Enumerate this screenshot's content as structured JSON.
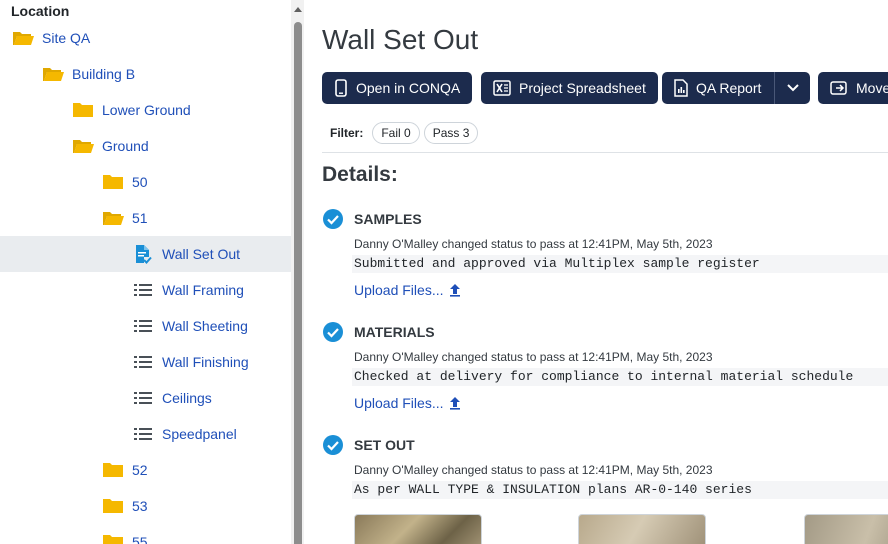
{
  "sidebar": {
    "title": "Location",
    "items": [
      {
        "label": "Site QA",
        "icon": "folder-open-icon"
      },
      {
        "label": "Building B",
        "icon": "folder-open-icon"
      },
      {
        "label": "Lower Ground",
        "icon": "folder-icon"
      },
      {
        "label": "Ground",
        "icon": "folder-open-icon"
      },
      {
        "label": "50",
        "icon": "folder-icon"
      },
      {
        "label": "51",
        "icon": "folder-open-icon"
      },
      {
        "label": "Wall Set Out",
        "icon": "checked-document-icon",
        "selected": true
      },
      {
        "label": "Wall Framing",
        "icon": "list-icon"
      },
      {
        "label": "Wall Sheeting",
        "icon": "list-icon"
      },
      {
        "label": "Wall Finishing",
        "icon": "list-icon"
      },
      {
        "label": "Ceilings",
        "icon": "list-icon"
      },
      {
        "label": "Speedpanel",
        "icon": "list-icon"
      },
      {
        "label": "52",
        "icon": "folder-icon"
      },
      {
        "label": "53",
        "icon": "folder-icon"
      },
      {
        "label": "55",
        "icon": "folder-icon"
      }
    ]
  },
  "main": {
    "title": "Wall Set Out",
    "buttons": {
      "open_conqa": "Open in CONQA",
      "project_spreadsheet": "Project Spreadsheet",
      "qa_report": "QA Report",
      "move": "Move"
    },
    "filter": {
      "label": "Filter:",
      "fail": "Fail 0",
      "pass": "Pass 3"
    },
    "details_heading": "Details:",
    "sections": [
      {
        "title": "SAMPLES",
        "meta": "Danny O'Malley changed status to pass at 12:41PM, May 5th, 2023",
        "note": "Submitted and approved via Multiplex sample register",
        "upload": "Upload Files..."
      },
      {
        "title": "MATERIALS",
        "meta": "Danny O'Malley changed status to pass at 12:41PM, May 5th, 2023",
        "note": "Checked at delivery for compliance to internal material schedule",
        "upload": "Upload Files..."
      },
      {
        "title": "SET OUT",
        "meta": "Danny O'Malley changed status to pass at 12:41PM, May 5th, 2023",
        "note": "As per WALL TYPE & INSULATION plans AR-0-140 series"
      }
    ]
  },
  "colors": {
    "accent": "#1c2b4d",
    "link": "#1f4fb8",
    "folder": "#f5b800",
    "check": "#1a8fd6"
  }
}
